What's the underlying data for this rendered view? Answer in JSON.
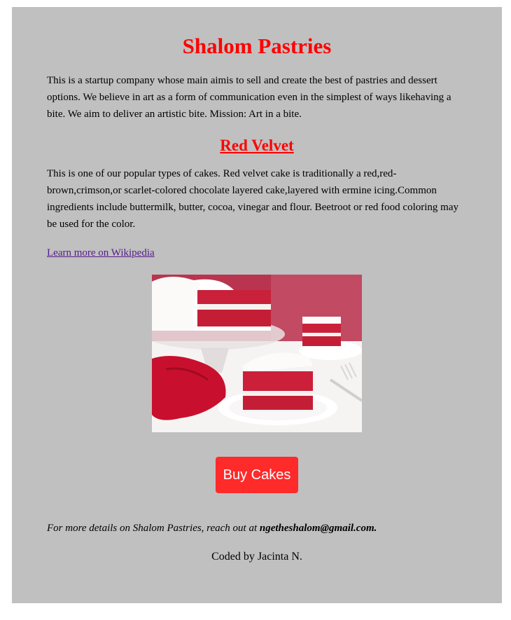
{
  "header": {
    "title": "Shalom Pastries",
    "intro": "This is a startup company whose main aimis to sell and create the best of pastries and dessert options. We believe in art as a form of communication even in the simplest of ways likehaving a bite. We aim to deliver an artistic bite. Mission: Art in a bite."
  },
  "product": {
    "name": "Red Velvet",
    "description": "This is one of our popular types of cakes. Red velvet cake is traditionally a red,red-brown,crimson,or scarlet-colored chocolate layered cake,layered with ermine icing.Common ingredients include buttermilk, butter, cocoa, vinegar and flour. Beetroot or red food coloring may be used for the color.",
    "link_label": "Learn more on Wikipedia",
    "image_alt": "Red velvet cake"
  },
  "cta": {
    "buy_label": "Buy Cakes"
  },
  "footer": {
    "contact_prefix": "For more details on Shalom Pastries, reach out at ",
    "email": "ngetheshalom@gmail.com.",
    "credit": "Coded by Jacinta N."
  },
  "colors": {
    "background_panel": "#c0c0c0",
    "heading": "#ff0000",
    "button": "#ff2a2a",
    "link": "#551a8b"
  }
}
